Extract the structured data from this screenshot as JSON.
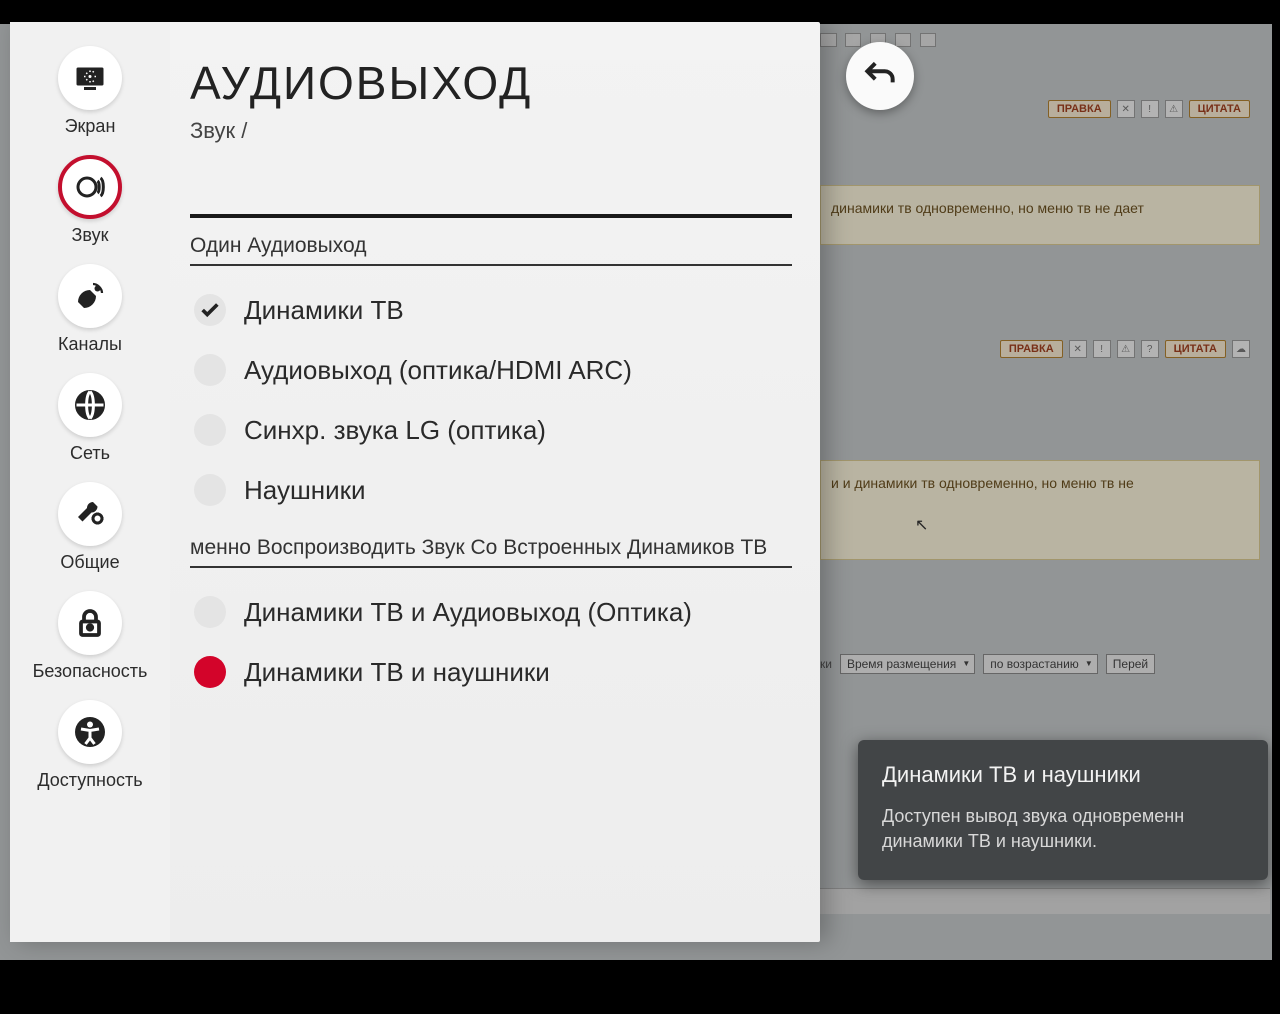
{
  "sidebar": {
    "items": [
      {
        "label": "Экран"
      },
      {
        "label": "Звук"
      },
      {
        "label": "Каналы"
      },
      {
        "label": "Сеть"
      },
      {
        "label": "Общие"
      },
      {
        "label": "Безопасность"
      },
      {
        "label": "Доступность"
      }
    ]
  },
  "main": {
    "title": "АУДИОВЫХОД",
    "breadcrumb": "Звук /",
    "section1": "Один Аудиовыход",
    "options1": [
      "Динамики ТВ",
      "Аудиовыход (оптика/HDMI ARC)",
      "Синхр. звука LG (оптика)",
      "Наушники"
    ],
    "section2": "менно Воспроизводить Звук Со Встроенных Динамиков ТВ",
    "options2": [
      "Динамики ТВ и Аудиовыход (Оптика)",
      "Динамики ТВ и наушники"
    ]
  },
  "tooltip": {
    "title": "Динамики ТВ и наушники",
    "body": "Доступен вывод звука одновременн динамики ТВ и наушники."
  },
  "background": {
    "btn_edit": "ПРАВКА",
    "btn_quote": "ЦИТАТА",
    "post1": "динамики тв одновременно, но меню тв не дает",
    "post2": "и и динамики тв одновременно, но меню тв не",
    "sort_time": "Время размещения",
    "sort_order": "по возрастанию",
    "go": "Перей"
  }
}
